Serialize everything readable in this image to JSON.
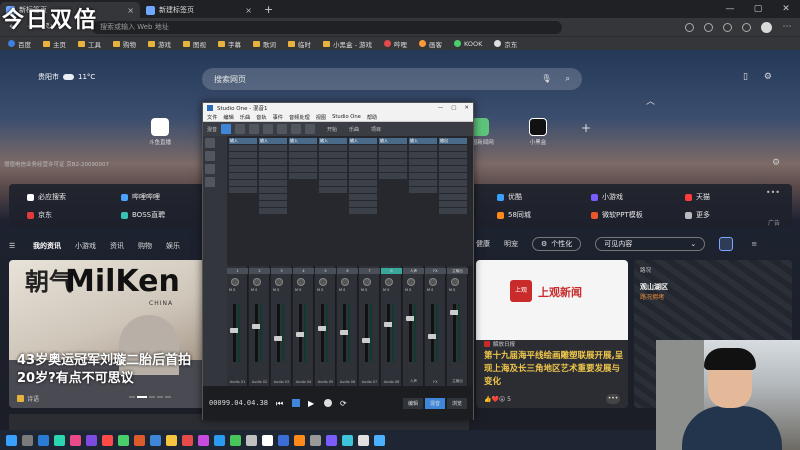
{
  "browser": {
    "tabs": [
      {
        "label": "新标签页",
        "active": true
      },
      {
        "label": "新建标签页",
        "active": false
      }
    ],
    "new_tab": "+",
    "address_placeholder": "搜索或输入 Web 地址",
    "bookmarks": [
      "百度",
      "主页",
      "工具",
      "购物",
      "游戏",
      "图视",
      "字幕",
      "歌词",
      "临时",
      "小黑盒 - 游戏",
      "哔哩",
      "画客",
      "KOOK",
      "京东"
    ]
  },
  "overlay": {
    "watermark": "今日双倍"
  },
  "page": {
    "weather": {
      "city": "贵阳市",
      "temp": "11°C"
    },
    "search_placeholder": "搜索网页",
    "tiles_left": [
      {
        "label": "斗鱼直播"
      }
    ],
    "tiles_right": [
      {
        "label": "中国新闻网"
      },
      {
        "label": "小黑盒"
      }
    ],
    "small_note": "增值电信业务经营许可证 京B2-20090007",
    "quick_links": [
      {
        "label": "必应搜索",
        "color": "#ffffff"
      },
      {
        "label": "哔哩哔哩",
        "color": "#4aa3ff"
      },
      {
        "label": "京东",
        "color": "#e23a3a"
      },
      {
        "label": "BOSS直聘",
        "color": "#36c2b4"
      },
      {
        "label": "优酷",
        "color": "#3aa0ff"
      },
      {
        "label": "小游戏",
        "color": "#7a5cff"
      },
      {
        "label": "天猫",
        "color": "#ff3b3b"
      },
      {
        "label": "58同城",
        "color": "#ff8a1a"
      },
      {
        "label": "微软PPT模板",
        "color": "#e7572a"
      },
      {
        "label": "更多",
        "color": "#bbbbbb"
      }
    ],
    "quick_more": "•••",
    "ad_label": "广告",
    "nav_tabs": [
      "我的资讯",
      "小游戏",
      "资讯",
      "购物",
      "娱乐"
    ],
    "nav_right": [
      "健康",
      "明宠"
    ],
    "personalize": "个性化",
    "visible_content": "可见内容",
    "card1": {
      "brand_left": "朝气",
      "brand_right": "MilKen",
      "brand_sub": "CHINA",
      "title": "43岁奥运冠军刘璇二胎后首拍20岁?有点不可思议",
      "source": "诗语"
    },
    "card2": {
      "logo": "上观",
      "brand": "上观新闻",
      "source": "解放日报",
      "title": "第十九届海平线绘画雕塑联展开展,呈现上海及长三角地区艺术重要发展与变化",
      "likes": "👍❤️😮 5"
    },
    "card3": {
      "label": "路况",
      "place": "观山湖区",
      "alert": "路况拥堵"
    }
  },
  "studio_one": {
    "title": "Studio One - 混音1",
    "menu": [
      "文件",
      "编辑",
      "乐曲",
      "音轨",
      "事件",
      "音频处理",
      "视图",
      "Studio One",
      "帮助"
    ],
    "toolbar_labels": [
      "混音",
      "开始",
      "乐曲",
      "项目"
    ],
    "routing_headers": [
      "输入",
      "输入",
      "输入",
      "输入",
      "输入",
      "输入",
      "输入",
      "输出"
    ],
    "channels": [
      {
        "name": "1",
        "label": "Audio 01"
      },
      {
        "name": "2",
        "label": "Audio 02"
      },
      {
        "name": "3",
        "label": "Audio 03"
      },
      {
        "name": "4",
        "label": "Audio 04"
      },
      {
        "name": "5",
        "label": "Audio 05"
      },
      {
        "name": "6",
        "label": "Audio 06"
      },
      {
        "name": "7",
        "label": "Audio 07"
      },
      {
        "name": "8",
        "label": "Audio 08",
        "selected": true
      },
      {
        "name": "人声",
        "label": "人声"
      },
      {
        "name": "FX",
        "label": "FX"
      },
      {
        "name": "主输出",
        "label": "主输出"
      }
    ],
    "time": "00099.04.04.38",
    "tabs": [
      "编辑",
      "混音",
      "浏览"
    ]
  }
}
